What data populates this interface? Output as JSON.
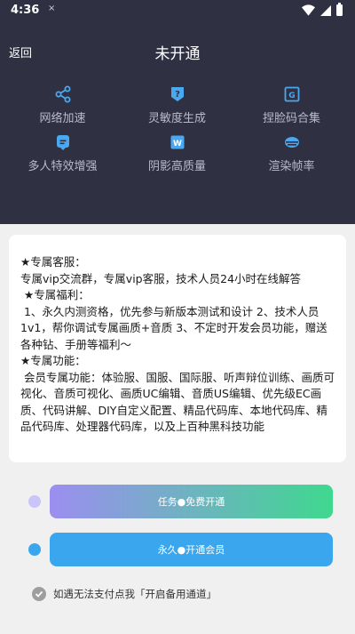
{
  "status_bar": {
    "time": "4:36",
    "notification": "×"
  },
  "nav": {
    "back_label": "返回",
    "title": "未开通"
  },
  "features": [
    {
      "label": "网络加速",
      "icon": "share-icon"
    },
    {
      "label": "灵敏度生成",
      "icon": "question-shield-icon"
    },
    {
      "label": "捏脸码合集",
      "icon": "g-image-icon"
    },
    {
      "label": "多人特效增强",
      "icon": "chat-bubble-icon"
    },
    {
      "label": "阴影高质量",
      "icon": "w-image-icon"
    },
    {
      "label": "渲染帧率",
      "icon": "cloud-icon"
    }
  ],
  "benefits": {
    "p1": "★专属客服：\n专属vip交流群，专属vip客服，技术人员24小时在线解答\n ★专属福利：\n 1、永久内测资格，优先参与新版本测试和设计 2、技术人员1v1，帮你调试专属画质+音质 3、不定时开发会员功能，赠送各种钻、手册等福利～\n★专属功能：\n 会员专属功能：体验服、国服、国际服、听声辩位训练、画质可视化、音质可视化、画质UC编辑、音质US编辑、优先级EC画质、代码讲解、DIY自定义配置、精品代码库、本地代码库、精品代码库、处理器代码库，以及上百种黑科技功能"
  },
  "buttons": {
    "free_label": "任务●免费开通",
    "vip_label": "永久●开通会员"
  },
  "footer": {
    "note": "如遇无法支付点我「开启备用通道」"
  },
  "colors": {
    "header_bg": "#303043",
    "feature_icon": "#4aa8f0",
    "free_gradient_start": "#9c8ef0",
    "free_gradient_end": "#3fd88f",
    "vip_button": "#3aa6ee",
    "free_dot": "#c9c4fa",
    "vip_dot": "#3aa6ee"
  }
}
